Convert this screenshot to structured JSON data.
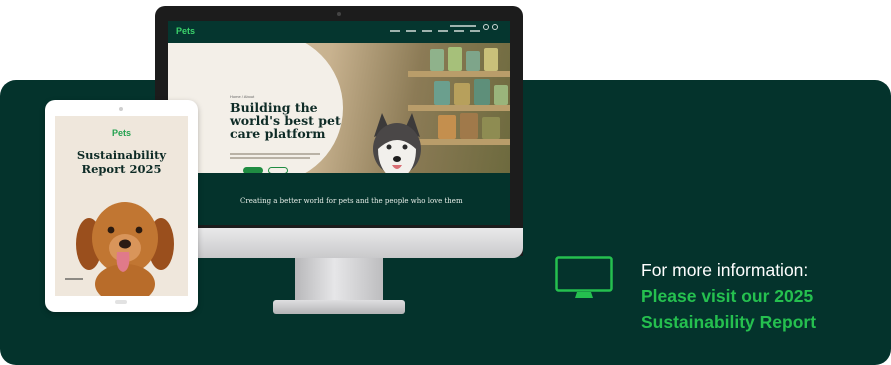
{
  "colors": {
    "banner_bg": "#04332c",
    "accent_green": "#25c04f",
    "text_white": "#ffffff"
  },
  "monitor": {
    "site_logo": "Pets",
    "breadcrumb": "Home / About",
    "hero_title_lines": [
      "Building the",
      "world's best pet",
      "care platform"
    ],
    "subheading": "Creating a better world for pets and the people who love them"
  },
  "tablet": {
    "logo": "Pets",
    "title_lines": [
      "Sustainability",
      "Report 2025"
    ]
  },
  "info": {
    "icon": "monitor-icon",
    "line1": "For more information:",
    "line2": "Please visit our 2025",
    "line3": "Sustainability Report"
  }
}
